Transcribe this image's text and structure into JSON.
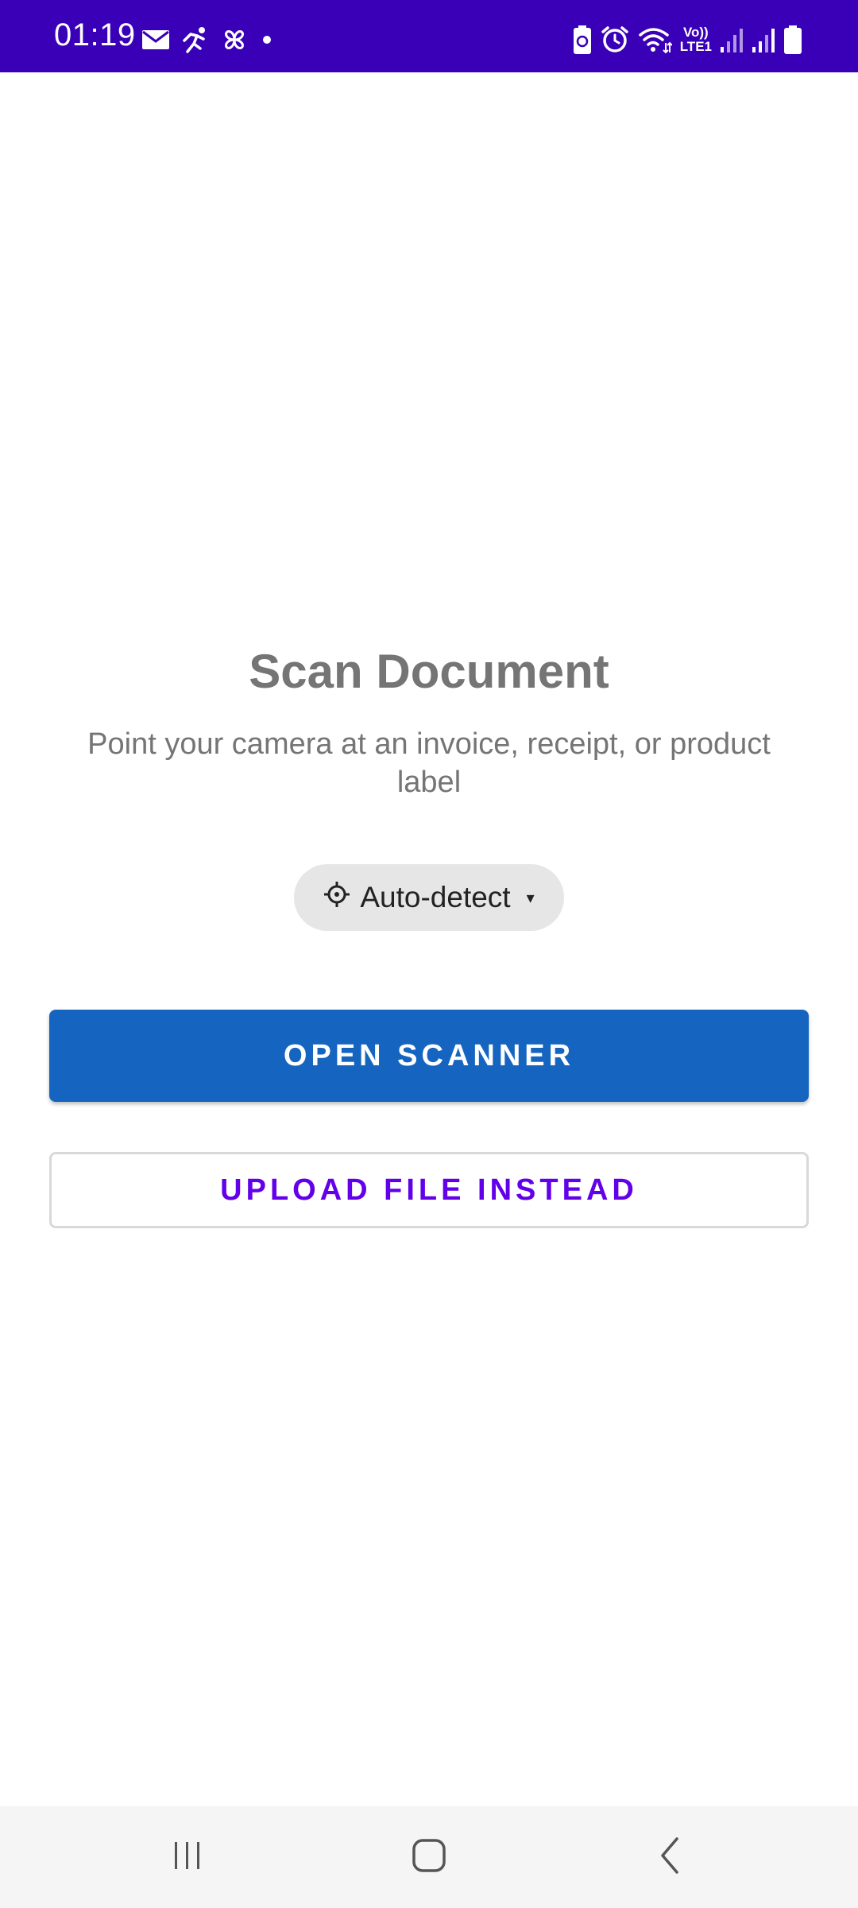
{
  "status_bar": {
    "time": "01:19",
    "background": "#3a00b8",
    "left_icons": [
      "mail-icon",
      "activity-icon",
      "pinwheel-icon",
      "dot-icon"
    ],
    "right_icons": [
      "battery-saver-icon",
      "alarm-icon",
      "wifi-icon",
      "volte-icon",
      "signal-icon",
      "signal-icon",
      "battery-icon"
    ],
    "volte_label_top": "Vo))",
    "volte_label_bottom": "LTE1"
  },
  "main": {
    "title": "Scan Document",
    "subtitle": "Point your camera at an invoice, receipt, or product label",
    "mode_selector": {
      "icon": "auto-detect-icon",
      "label": "Auto-detect",
      "arrow": "▾"
    },
    "primary_button": {
      "label": "OPEN SCANNER",
      "color": "#1565c0"
    },
    "secondary_button": {
      "label": "UPLOAD FILE INSTEAD",
      "color": "#6200ea"
    }
  },
  "nav_bar": {
    "buttons": [
      "recents-icon",
      "home-icon",
      "back-icon"
    ]
  }
}
